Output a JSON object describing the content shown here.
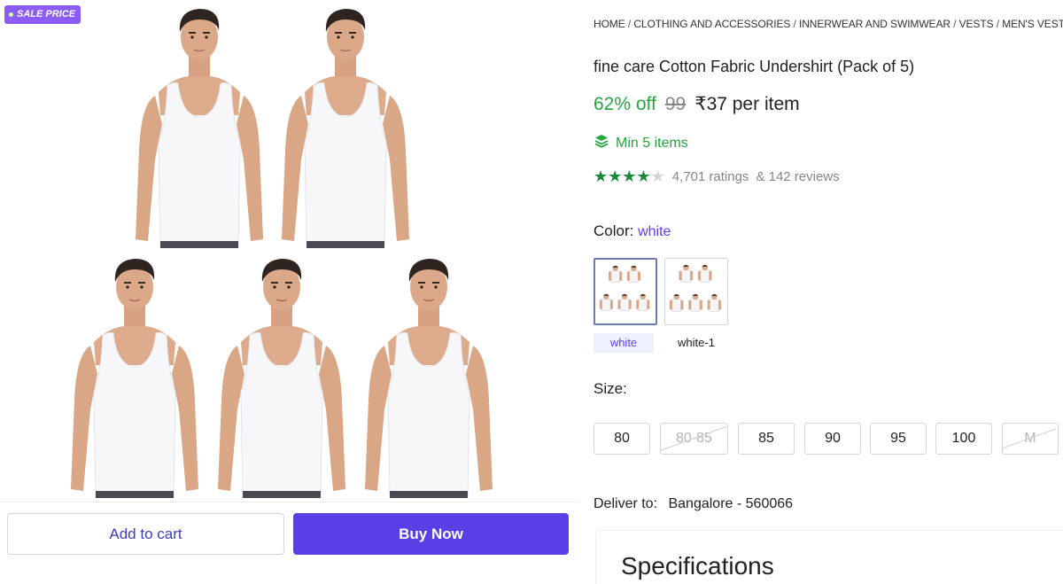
{
  "gallery": {
    "badge": "SALE PRICE",
    "image_alt": "models wearing white vests",
    "icon": "sale-dot-icon"
  },
  "actions": {
    "add_to_cart": "Add to cart",
    "buy_now": "Buy Now"
  },
  "breadcrumb": [
    "HOME",
    "CLOTHING AND ACCESSORIES",
    "INNERWEAR AND SWIMWEAR",
    "VESTS",
    "MEN'S VESTS"
  ],
  "breadcrumb_sep": "/",
  "product": {
    "title": "fine care Cotton Fabric Undershirt (Pack of 5)",
    "discount": "62% off",
    "mrp": "99",
    "price": "₹37 per item",
    "min_items": "Min 5 items",
    "min_items_icon": "layers-icon",
    "rating_value": 4,
    "rating_max": 5,
    "ratings": "4,701 ratings",
    "reviews": "& 142 reviews"
  },
  "color": {
    "label": "Color:",
    "value": "white",
    "options": [
      {
        "label": "white",
        "selected": true
      },
      {
        "label": "white-1",
        "selected": false
      }
    ]
  },
  "size": {
    "label": "Size:",
    "options": [
      {
        "label": "80",
        "available": true
      },
      {
        "label": "80-85",
        "available": false
      },
      {
        "label": "85",
        "available": true
      },
      {
        "label": "90",
        "available": true
      },
      {
        "label": "95",
        "available": true
      },
      {
        "label": "100",
        "available": true
      },
      {
        "label": "M",
        "available": false
      }
    ]
  },
  "delivery": {
    "label": "Deliver to:",
    "location": "Bangalore - 560066"
  },
  "specifications": {
    "title": "Specifications"
  },
  "colors": {
    "accent": "#5b3fe6",
    "green": "#26a541",
    "badge": "#8b5cf6"
  }
}
